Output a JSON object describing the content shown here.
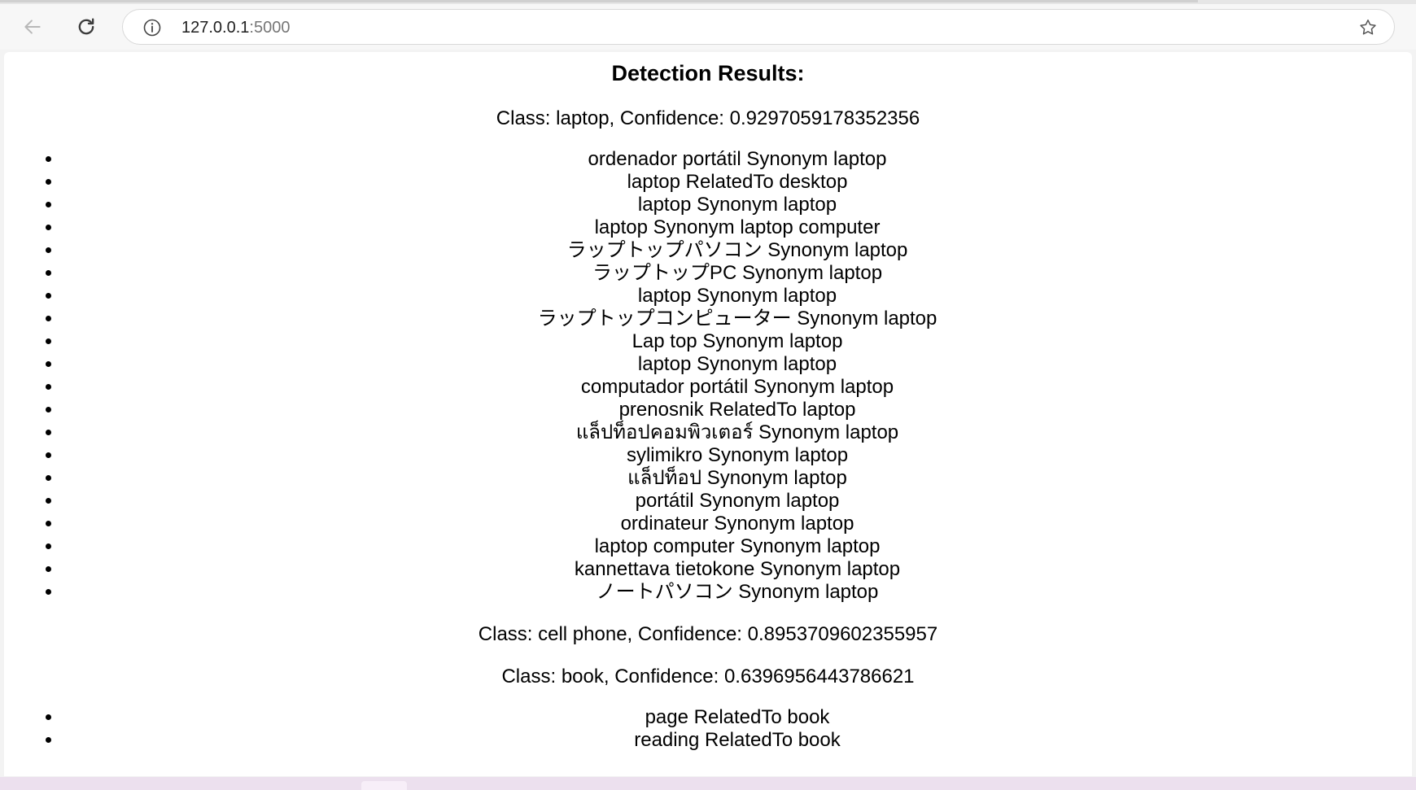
{
  "browser": {
    "url_host": "127.0.0.1",
    "url_port": ":5000"
  },
  "page": {
    "title": "Detection Results:",
    "detections": [
      {
        "label": "Class: laptop, Confidence: 0.9297059178352356",
        "relations": [
          "ordenador portátil Synonym laptop",
          "laptop RelatedTo desktop",
          "laptop Synonym laptop",
          "laptop Synonym laptop computer",
          "ラップトップパソコン Synonym laptop",
          "ラップトップPC Synonym laptop",
          "laptop Synonym laptop",
          "ラップトップコンピューター Synonym laptop",
          "Lap top Synonym laptop",
          "laptop Synonym laptop",
          "computador portátil Synonym laptop",
          "prenosnik RelatedTo laptop",
          "แล็ปท็อปคอมพิวเตอร์ Synonym laptop",
          "sylimikro Synonym laptop",
          "แล็ปท็อป Synonym laptop",
          "portátil Synonym laptop",
          "ordinateur Synonym laptop",
          "laptop computer Synonym laptop",
          "kannettava tietokone Synonym laptop",
          "ノートパソコン Synonym laptop"
        ]
      },
      {
        "label": "Class: cell phone, Confidence: 0.8953709602355957",
        "relations": []
      },
      {
        "label": "Class: book, Confidence: 0.6396956443786621",
        "relations": [
          "page RelatedTo book",
          "reading RelatedTo book"
        ]
      }
    ]
  },
  "colors": {
    "page_background": "#ffffff",
    "chrome_background": "#f7f7f7",
    "text": "#000000",
    "url_port": "#767676"
  },
  "icons": {
    "back": "arrow-left-icon",
    "reload": "reload-icon",
    "site_info": "info-icon",
    "bookmark": "star-icon"
  }
}
